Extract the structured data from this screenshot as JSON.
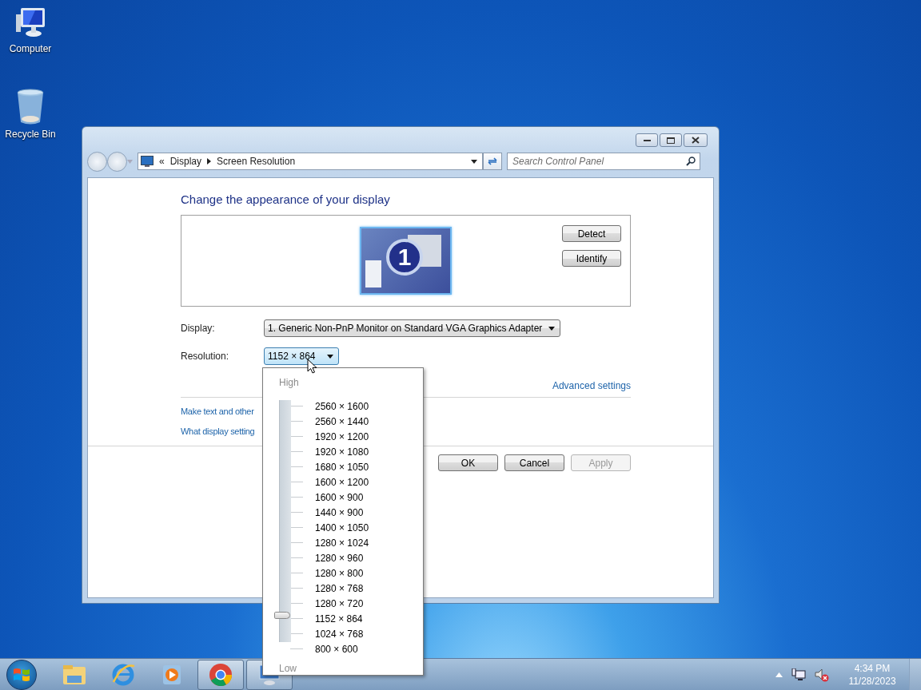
{
  "desktop_icons": [
    {
      "kind": "computer",
      "label": "Computer"
    },
    {
      "kind": "recycle",
      "label": "Recycle Bin"
    }
  ],
  "window": {
    "address": {
      "overflow": "«",
      "breadcrumb": [
        "Display",
        "Screen Resolution"
      ]
    },
    "search": {
      "placeholder": "Search Control Panel"
    },
    "heading": "Change the appearance of your display",
    "monitor_number": "1",
    "side_buttons": [
      "Detect",
      "Identify"
    ],
    "display": {
      "label": "Display:",
      "value": "1. Generic Non-PnP Monitor on Standard VGA Graphics Adapter"
    },
    "resolution": {
      "label": "Resolution:",
      "value": "1152 × 864",
      "expanded": true
    },
    "advanced_link": "Advanced settings",
    "links": [
      "Make text and other",
      "What display setting"
    ],
    "buttons": [
      {
        "label": "OK",
        "disabled": false
      },
      {
        "label": "Cancel",
        "disabled": false
      },
      {
        "label": "Apply",
        "disabled": true
      }
    ]
  },
  "resolution_dropdown": {
    "high": "High",
    "low": "Low",
    "level": 0.125,
    "options": [
      "2560 × 1600",
      "2560 × 1440",
      "1920 × 1200",
      "1920 × 1080",
      "1680 × 1050",
      "1600 × 1200",
      "1600 × 900",
      "1440 × 900",
      "1400 × 1050",
      "1280 × 1024",
      "1280 × 960",
      "1280 × 800",
      "1280 × 768",
      "1280 × 720",
      "1152 × 864",
      "1024 × 768",
      "800 × 600"
    ]
  },
  "taskbar": {
    "pinned": [
      {
        "kind": "folder",
        "running": false
      },
      {
        "kind": "browser-e",
        "running": false
      },
      {
        "kind": "media",
        "running": false
      },
      {
        "kind": "chrome",
        "running": true
      },
      {
        "kind": "display",
        "running": true
      }
    ],
    "clock": {
      "time": "4:34 PM",
      "date": "11/28/2023"
    }
  }
}
